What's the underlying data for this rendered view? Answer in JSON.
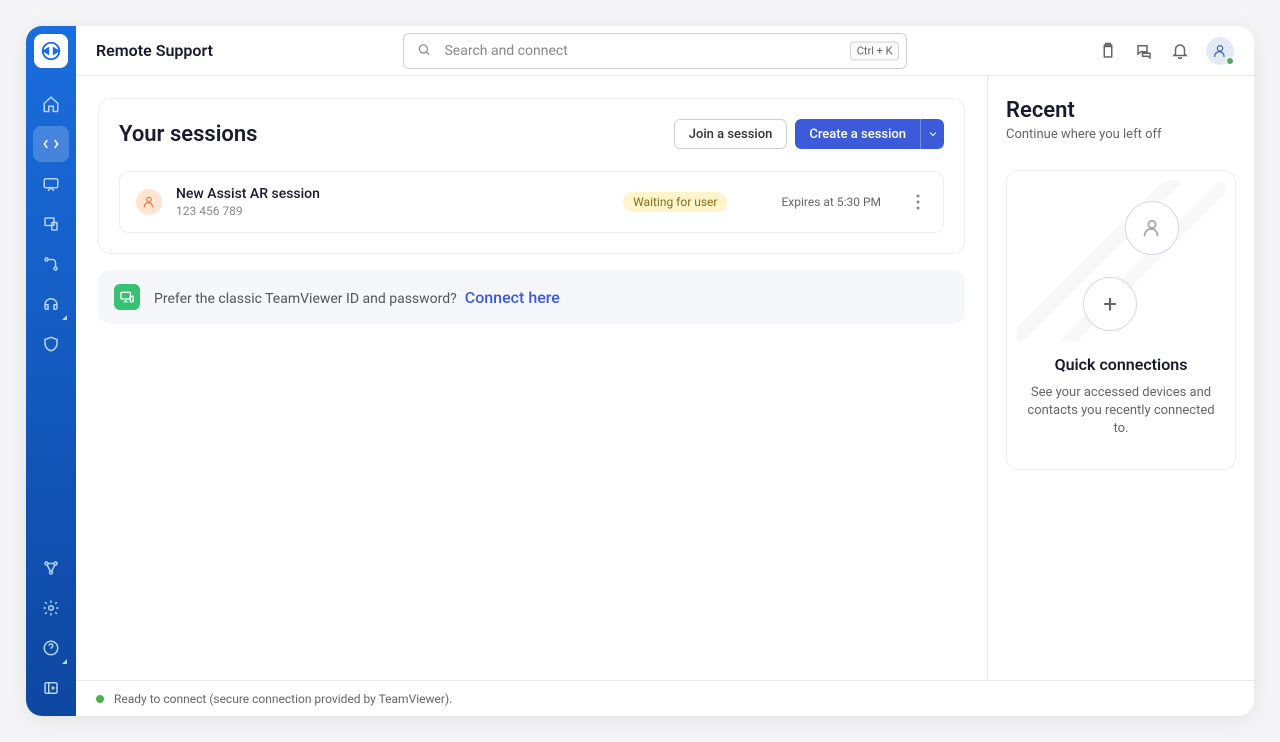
{
  "header": {
    "title": "Remote Support",
    "search_placeholder": "Search and connect",
    "shortcut": "Ctrl + K"
  },
  "sessions": {
    "title": "Your sessions",
    "join_label": "Join a session",
    "create_label": "Create a session",
    "items": [
      {
        "name": "New Assist AR session",
        "id": "123 456 789",
        "status": "Waiting for user",
        "expires": "Expires at 5:30 PM"
      }
    ]
  },
  "classic": {
    "text": "Prefer the classic TeamViewer ID and password?",
    "link": "Connect here"
  },
  "recent": {
    "title": "Recent",
    "subtitle": "Continue where you left off",
    "quick_title": "Quick connections",
    "quick_desc": "See your accessed devices and contacts you recently connected to."
  },
  "status": {
    "text": "Ready to connect (secure connection provided by TeamViewer)."
  }
}
